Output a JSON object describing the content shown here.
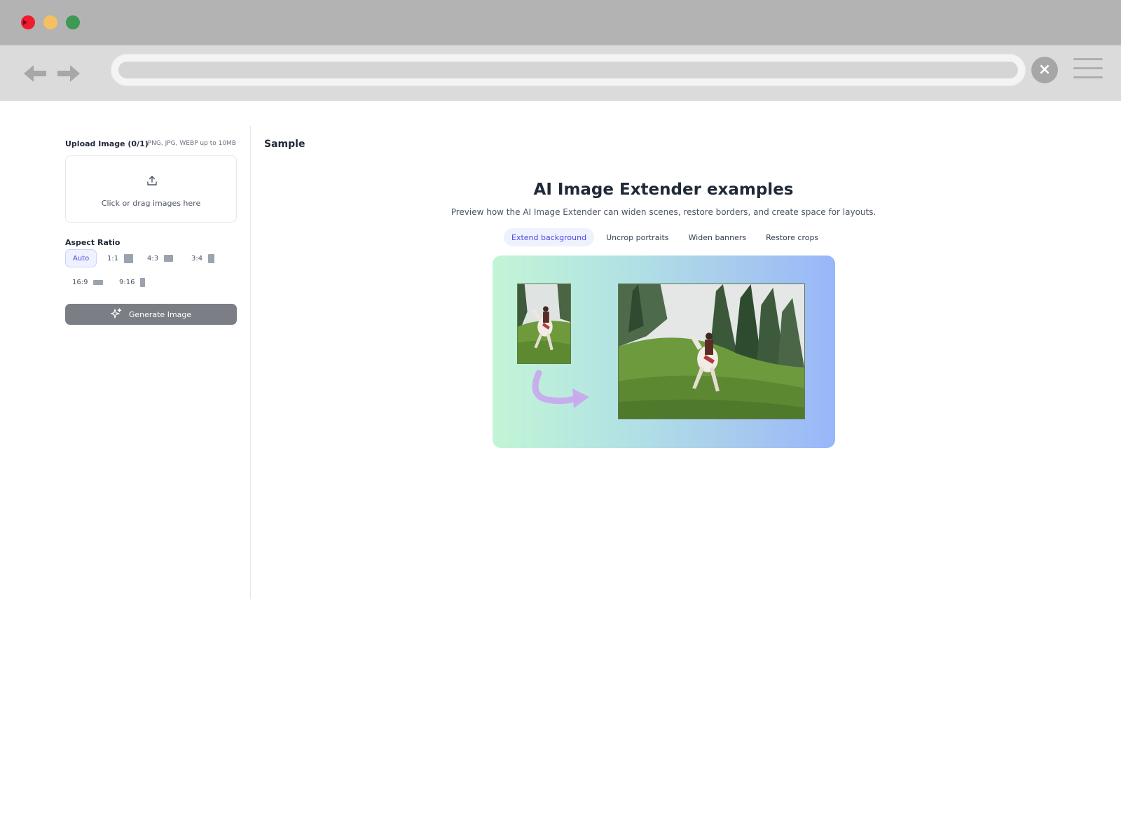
{
  "browser": {
    "close_icon": "×",
    "icons": [
      "back-arrow-icon",
      "forward-arrow-icon",
      "close-icon",
      "menu-icon"
    ]
  },
  "sidebar": {
    "upload": {
      "title": "Upload Image (0/1)",
      "hint": "PNG, JPG, WEBP up to 10MB",
      "drop_text": "Click or drag images here"
    },
    "aspect_ratio": {
      "label": "Aspect Ratio",
      "options": [
        "Auto",
        "1:1",
        "4:3",
        "3:4",
        "16:9",
        "9:16"
      ],
      "selected": "Auto"
    },
    "generate_label": "Generate Image"
  },
  "main": {
    "sample_label": "Sample",
    "title": "AI Image Extender examples",
    "subtitle": "Preview how the AI Image Extender can widen scenes, restore borders, and create space for layouts.",
    "tabs": [
      {
        "label": "Extend background",
        "active": true
      },
      {
        "label": "Uncrop portraits",
        "active": false
      },
      {
        "label": "Widen banners",
        "active": false
      },
      {
        "label": "Restore crops",
        "active": false
      }
    ]
  },
  "colors": {
    "accent": "#4f46e5",
    "accent_bg": "#eef2ff",
    "button": "#7b7e84",
    "gradient_start": "#c2f5d6",
    "gradient_end": "#98b6fa",
    "arrow": "#c9a6ef"
  }
}
